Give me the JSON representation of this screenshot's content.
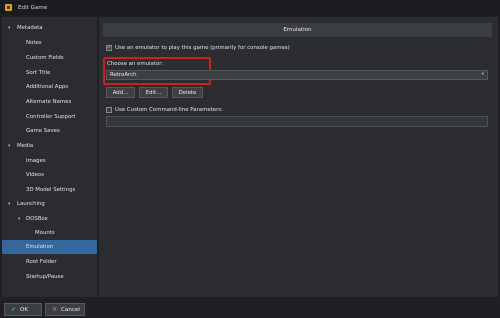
{
  "window": {
    "title": "Edit Game"
  },
  "sidebar": {
    "items": [
      {
        "label": "Metadata",
        "arrow": "▾",
        "level": 0
      },
      {
        "label": "Notes",
        "level": 1
      },
      {
        "label": "Custom Fields",
        "level": 1
      },
      {
        "label": "Sort Title",
        "level": 1
      },
      {
        "label": "Additional Apps",
        "level": 1
      },
      {
        "label": "Alternate Names",
        "level": 1
      },
      {
        "label": "Controller Support",
        "level": 1
      },
      {
        "label": "Game Saves",
        "level": 1
      },
      {
        "label": "Media",
        "arrow": "▾",
        "level": 0
      },
      {
        "label": "Images",
        "level": 1
      },
      {
        "label": "Videos",
        "level": 1
      },
      {
        "label": "3D Model Settings",
        "level": 1
      },
      {
        "label": "Launching",
        "arrow": "▾",
        "level": 0
      },
      {
        "label": "DOSBox",
        "arrow": "▾",
        "level": 1
      },
      {
        "label": "Mounts",
        "level": 2
      },
      {
        "label": "Emulation",
        "level": 1,
        "selected": true
      },
      {
        "label": "Root Folder",
        "level": 1
      },
      {
        "label": "Startup/Pause",
        "level": 1
      }
    ]
  },
  "main": {
    "section_title": "Emulation",
    "use_emulator": {
      "label": "Use an emulator to play this game (primarily for console games)",
      "checked": "✓"
    },
    "choose_emulator": {
      "label": "Choose an emulator:",
      "selected": "RetroArch",
      "arrow": "▾"
    },
    "buttons": {
      "add": "Add...",
      "edit": "Edit...",
      "delete": "Delete"
    },
    "custom_params": {
      "label": "Use Custom Command-line Parameters:",
      "checked": "",
      "value": ""
    },
    "highlight_color": "#d41e1e"
  },
  "footer": {
    "ok": {
      "label": "OK",
      "icon": "✔",
      "icon_color": "#3fbf3f"
    },
    "cancel": {
      "label": "Cancel",
      "icon": "✖",
      "icon_color": "#e04040"
    }
  }
}
